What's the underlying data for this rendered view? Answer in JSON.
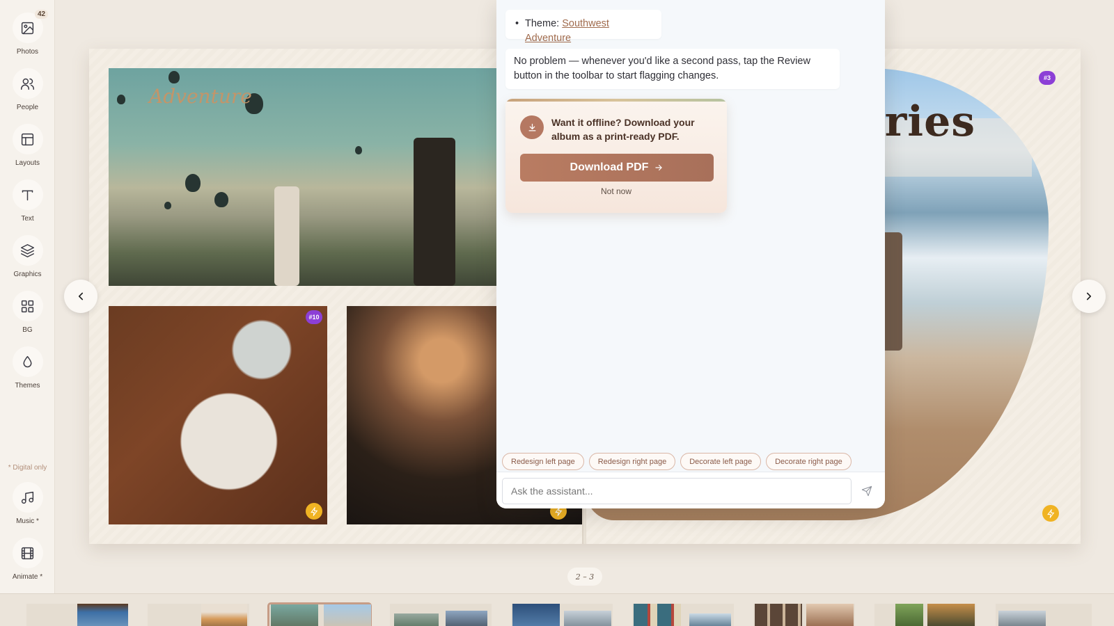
{
  "sidebar": {
    "photos_badge": "42",
    "tools": [
      {
        "label": "Photos",
        "icon": "image-icon"
      },
      {
        "label": "People",
        "icon": "users-icon"
      },
      {
        "label": "Layouts",
        "icon": "layout-icon"
      },
      {
        "label": "Text",
        "icon": "text-icon"
      },
      {
        "label": "Graphics",
        "icon": "layers-icon"
      },
      {
        "label": "BG",
        "icon": "grid-icon"
      },
      {
        "label": "Themes",
        "icon": "droplet-icon"
      }
    ],
    "digital_note": "* Digital only",
    "digital_tools": [
      {
        "label": "Music *",
        "icon": "music-icon"
      },
      {
        "label": "Animate *",
        "icon": "film-icon"
      }
    ]
  },
  "spread": {
    "left_title": "Adventure",
    "right_title": "emories",
    "tags": {
      "crafts": "#10",
      "beach": "#3"
    },
    "page_indicator": "2 – 3"
  },
  "assistant": {
    "theme_label": "Theme:",
    "theme_value": "Southwest Adventure",
    "reply": "No problem — whenever you'd like a second pass, tap the Review button in the toolbar to start flagging changes.",
    "offline_card": {
      "message": "Want it offline? Download your album as a print-ready PDF.",
      "download_label": "Download PDF",
      "dismiss_label": "Not now"
    },
    "suggestions": [
      "Redesign left page",
      "Redesign right page",
      "Decorate left page",
      "Decorate right page"
    ],
    "input_placeholder": "Ask the assistant..."
  },
  "colors": {
    "accent": "#b57862",
    "badge_purple": "#8c3fd6",
    "bolt_yellow": "#f0b323"
  }
}
